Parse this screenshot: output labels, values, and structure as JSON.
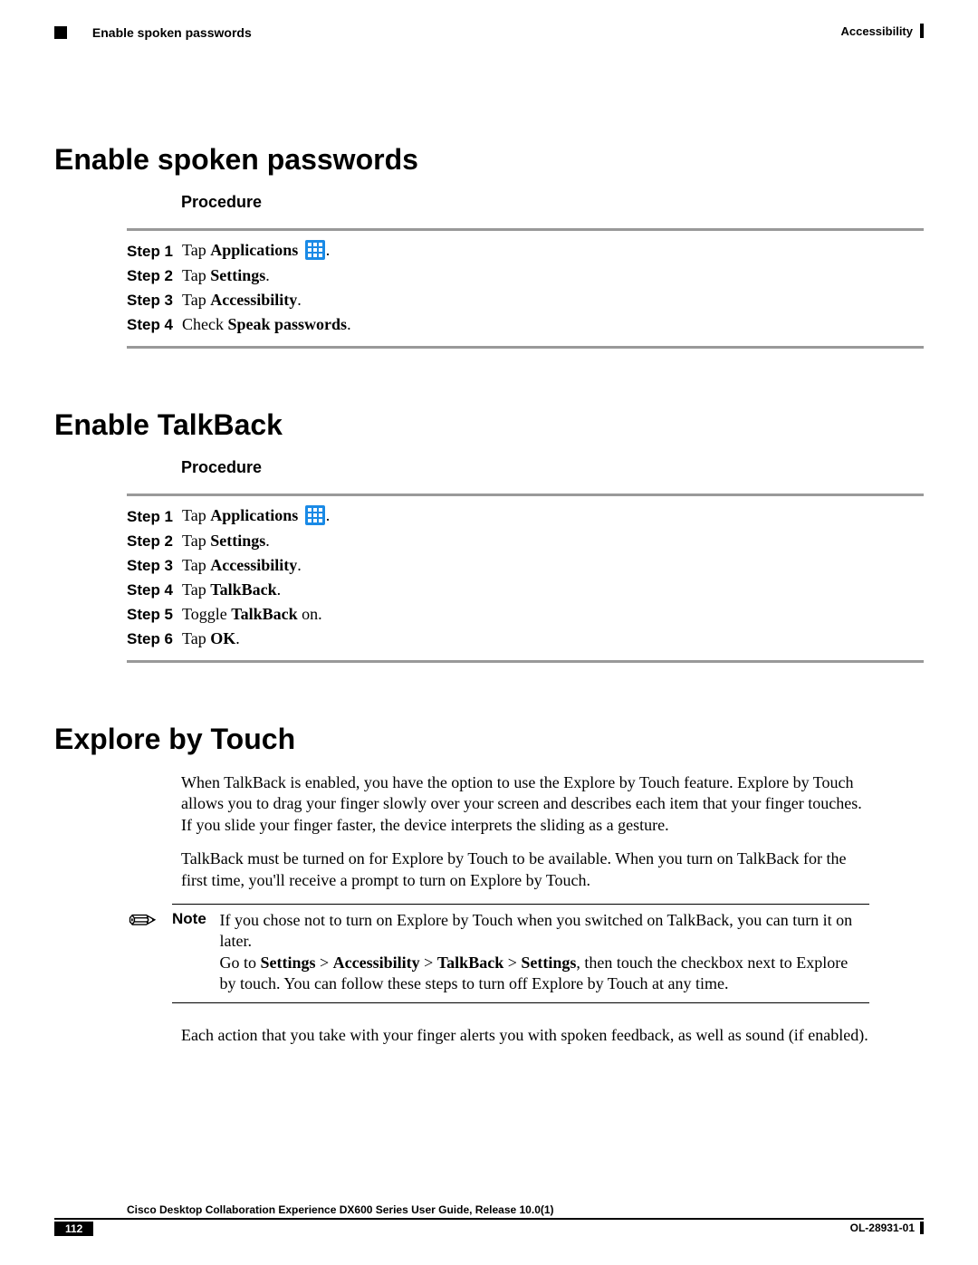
{
  "header": {
    "left": "Enable spoken passwords",
    "right": "Accessibility"
  },
  "section1": {
    "title": "Enable spoken passwords",
    "procedure_label": "Procedure",
    "steps": [
      {
        "label": "Step 1",
        "prefix": "Tap ",
        "bold": "Applications",
        "has_icon": true,
        "suffix": "."
      },
      {
        "label": "Step 2",
        "prefix": "Tap ",
        "bold": "Settings",
        "has_icon": false,
        "suffix": "."
      },
      {
        "label": "Step 3",
        "prefix": "Tap ",
        "bold": "Accessibility",
        "has_icon": false,
        "suffix": "."
      },
      {
        "label": "Step 4",
        "prefix": "Check ",
        "bold": "Speak passwords",
        "has_icon": false,
        "suffix": "."
      }
    ]
  },
  "section2": {
    "title": "Enable TalkBack",
    "procedure_label": "Procedure",
    "steps": [
      {
        "label": "Step 1",
        "prefix": "Tap ",
        "bold": "Applications",
        "has_icon": true,
        "suffix": "."
      },
      {
        "label": "Step 2",
        "prefix": "Tap ",
        "bold": "Settings",
        "has_icon": false,
        "suffix": "."
      },
      {
        "label": "Step 3",
        "prefix": "Tap ",
        "bold": "Accessibility",
        "has_icon": false,
        "suffix": "."
      },
      {
        "label": "Step 4",
        "prefix": "Tap ",
        "bold": "TalkBack",
        "has_icon": false,
        "suffix": "."
      },
      {
        "label": "Step 5",
        "prefix": "Toggle ",
        "bold": "TalkBack",
        "has_icon": false,
        "suffix": " on."
      },
      {
        "label": "Step 6",
        "prefix": "Tap ",
        "bold": "OK",
        "has_icon": false,
        "suffix": "."
      }
    ]
  },
  "section3": {
    "title": "Explore by Touch",
    "para1": "When TalkBack is enabled, you have the option to use the Explore by Touch feature. Explore by Touch allows you to drag your finger slowly over your screen and describes each item that your finger touches. If you slide your finger faster, the device interprets the sliding as a gesture.",
    "para2": "TalkBack must be turned on for Explore by Touch to be available. When you turn on TalkBack for the first time, you'll receive a prompt to turn on Explore by Touch.",
    "note_label": "Note",
    "note_line1": "If you chose not to turn on Explore by Touch when you switched on TalkBack, you can turn it on later.",
    "note_line2_pre": "Go to ",
    "note_path1": "Settings",
    "note_gt": " > ",
    "note_path2": "Accessibility",
    "note_path3": "TalkBack",
    "note_path4": "Settings",
    "note_line2_post": ", then touch the checkbox next to Explore by touch. You can follow these steps to turn off Explore by Touch at any time.",
    "para3": "Each action that you take with your finger alerts you with spoken feedback, as well as sound (if enabled)."
  },
  "footer": {
    "title": "Cisco Desktop Collaboration Experience DX600 Series User Guide, Release 10.0(1)",
    "page": "112",
    "docid": "OL-28931-01"
  }
}
